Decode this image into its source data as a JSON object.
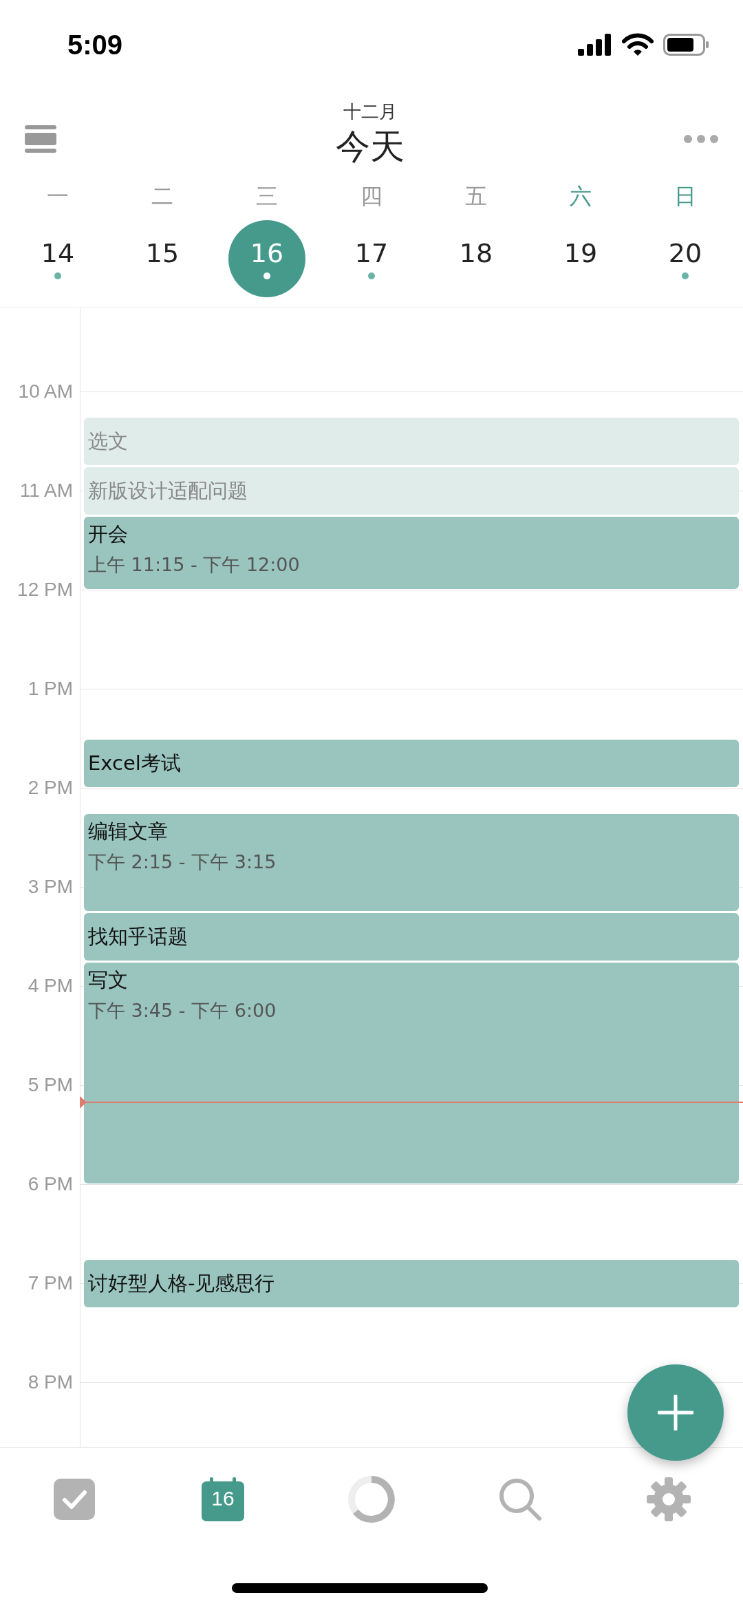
{
  "status_bar": {
    "time": "5:09"
  },
  "header": {
    "month": "十二月",
    "title": "今天"
  },
  "weekdays": [
    {
      "label": "一",
      "weekend": false
    },
    {
      "label": "二",
      "weekend": false
    },
    {
      "label": "三",
      "weekend": false
    },
    {
      "label": "四",
      "weekend": false
    },
    {
      "label": "五",
      "weekend": false
    },
    {
      "label": "六",
      "weekend": true
    },
    {
      "label": "日",
      "weekend": true
    }
  ],
  "dates": [
    {
      "label": "14",
      "selected": false,
      "has_events": true
    },
    {
      "label": "15",
      "selected": false,
      "has_events": false
    },
    {
      "label": "16",
      "selected": true,
      "has_events": true
    },
    {
      "label": "17",
      "selected": false,
      "has_events": true
    },
    {
      "label": "18",
      "selected": false,
      "has_events": false
    },
    {
      "label": "19",
      "selected": false,
      "has_events": false
    },
    {
      "label": "20",
      "selected": false,
      "has_events": true
    }
  ],
  "hours": [
    "10 AM",
    "11 AM",
    "12 PM",
    "1 PM",
    "2 PM",
    "3 PM",
    "4 PM",
    "5 PM",
    "6 PM",
    "7 PM",
    "8 PM"
  ],
  "events": [
    {
      "title": "选文",
      "faded": true
    },
    {
      "title": "新版设计适配问题",
      "faded": true
    },
    {
      "title": "开会",
      "time_range": "上午 11:15 - 下午 12:00",
      "faded": false
    },
    {
      "title": "Excel考试",
      "faded": false
    },
    {
      "title": "编辑文章",
      "time_range": "下午 2:15 - 下午 3:15",
      "faded": false
    },
    {
      "title": "找知乎话题",
      "faded": false
    },
    {
      "title": "写文",
      "time_range": "下午 3:45 - 下午 6:00",
      "faded": false
    },
    {
      "title": "讨好型人格-见感思行",
      "faded": false
    }
  ],
  "tab_bar": [
    {
      "kind": "tasks",
      "selected": false
    },
    {
      "kind": "calendar",
      "label": "16",
      "selected": true
    },
    {
      "kind": "progress",
      "selected": false
    },
    {
      "kind": "search",
      "selected": false
    },
    {
      "kind": "settings",
      "selected": false
    }
  ]
}
